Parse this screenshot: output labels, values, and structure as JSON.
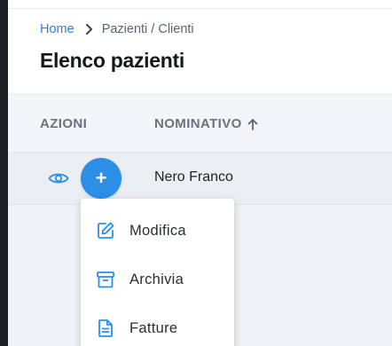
{
  "breadcrumb": {
    "home": "Home",
    "current": "Pazienti / Clienti"
  },
  "page": {
    "title": "Elenco pazienti"
  },
  "table": {
    "columns": {
      "actions": "AZIONI",
      "name": "NOMINATIVO"
    },
    "rows": [
      {
        "name": "Nero Franco"
      }
    ]
  },
  "actions": {
    "add_symbol": "+"
  },
  "menu": {
    "items": [
      {
        "label": "Modifica",
        "icon": "edit-icon"
      },
      {
        "label": "Archivia",
        "icon": "archive-icon"
      },
      {
        "label": "Fatture",
        "icon": "document-icon"
      }
    ]
  },
  "colors": {
    "accent": "#2b8fe6",
    "link": "#2f80d6",
    "title": "#16181d"
  }
}
